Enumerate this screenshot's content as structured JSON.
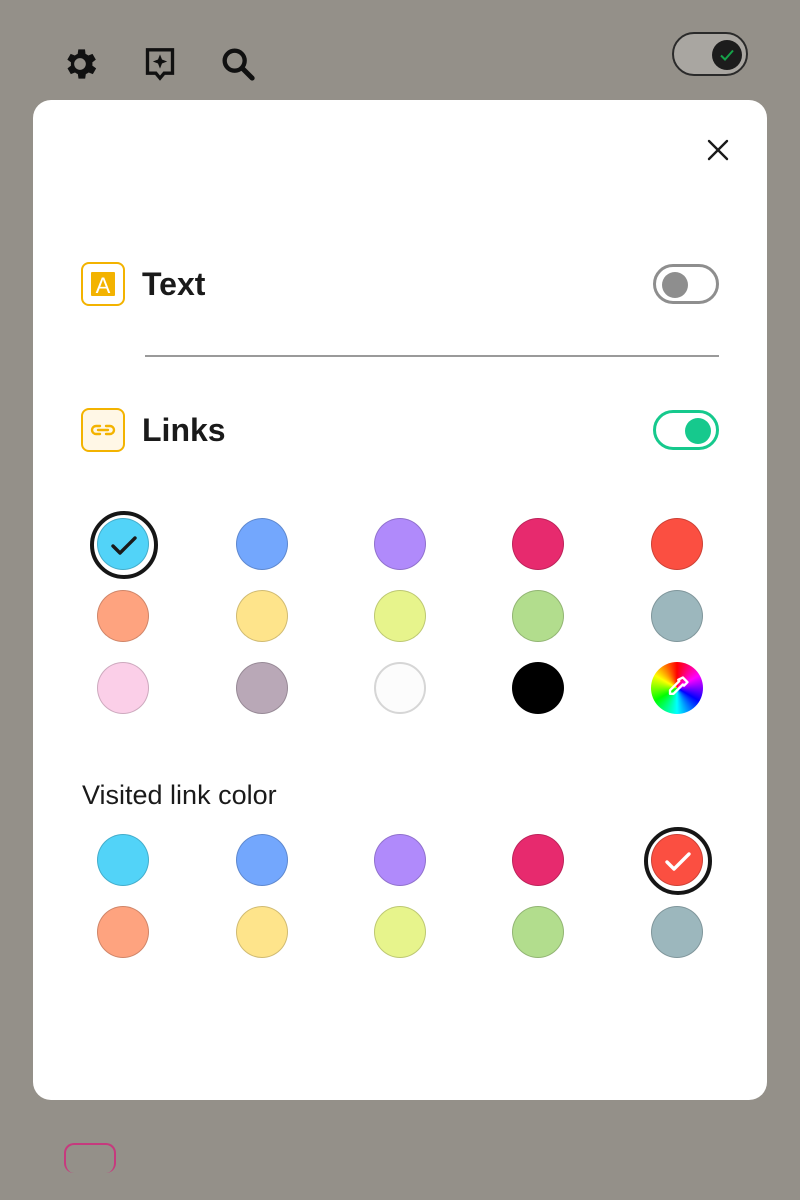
{
  "toolbar": {
    "icons": [
      "gear-icon",
      "sparkle-bubble-icon",
      "search-icon"
    ],
    "dark_mode_toggle": {
      "state": "on"
    }
  },
  "dialog": {
    "close_icon": "close-icon",
    "text_row": {
      "label": "Text",
      "icon": "text-A-icon",
      "toggle": "off"
    },
    "links_row": {
      "label": "Links",
      "icon": "link-icon",
      "toggle": "on"
    },
    "link_colors": {
      "selected": "#52d3f8",
      "swatches": [
        "#52d3f8",
        "#73a7fd",
        "#b08afb",
        "#e72a6e",
        "#fb4f41",
        "#fea37f",
        "#fee48b",
        "#e7f48c",
        "#b2dd8d",
        "#9cb7bd",
        "#fbcfe8",
        "#b9a8b7",
        "#fcfcfc",
        "#000000",
        "color-picker"
      ]
    },
    "visited": {
      "label": "Visited link color",
      "selected": "#fb4f41",
      "swatches": [
        "#52d3f8",
        "#73a7fd",
        "#b08afb",
        "#e72a6e",
        "#fb4f41",
        "#fea37f",
        "#fee48b",
        "#e7f48c",
        "#b2dd8d",
        "#9cb7bd"
      ]
    }
  },
  "colors": {
    "accent_yellow": "#f3b300",
    "toggle_on": "#16c98d",
    "toggle_off": "#8e8e8e",
    "backdrop": "#949089"
  }
}
